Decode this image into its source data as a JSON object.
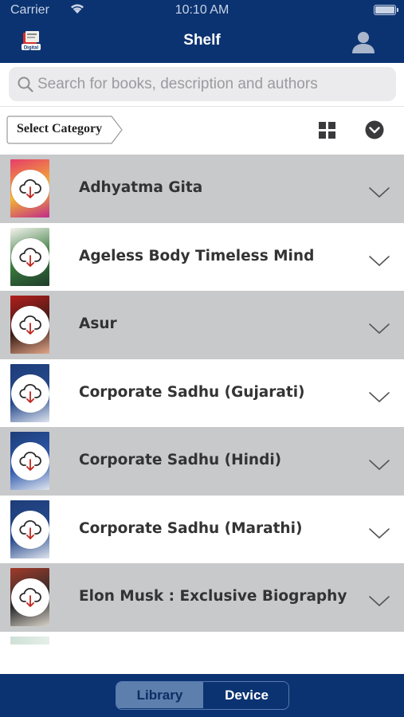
{
  "status_bar": {
    "carrier": "Carrier",
    "time": "10:10 AM"
  },
  "nav": {
    "title": "Shelf",
    "logo_icon": "digital-books-logo-icon",
    "profile_icon": "user-profile-icon"
  },
  "search": {
    "placeholder": "Search for books, description and authors",
    "value": ""
  },
  "filter": {
    "category_label": "Select Category",
    "grid_icon": "grid-view-icon",
    "sort_icon": "chevron-down-circle-icon"
  },
  "books": [
    {
      "title": "Adhyatma Gita",
      "cover_colors": [
        "#e63d6a",
        "#f5b531",
        "#c12c8a"
      ]
    },
    {
      "title": "Ageless Body Timeless Mind",
      "cover_colors": [
        "#f4f4ef",
        "#3a7a3d",
        "#1e3d2b"
      ]
    },
    {
      "title": "Asur",
      "cover_colors": [
        "#b21e1c",
        "#3b1c15",
        "#e1a68a"
      ]
    },
    {
      "title": "Corporate Sadhu (Gujarati)",
      "cover_colors": [
        "#1d3d78",
        "#274a8e",
        "#e0e5ee"
      ]
    },
    {
      "title": "Corporate Sadhu (Hindi)",
      "cover_colors": [
        "#1d3d78",
        "#2f5bb0",
        "#e0e5ee"
      ]
    },
    {
      "title": "Corporate Sadhu (Marathi)",
      "cover_colors": [
        "#1d3d78",
        "#274a8e",
        "#e0e5ee"
      ]
    },
    {
      "title": "Elon Musk : Exclusive Biography",
      "cover_colors": [
        "#a23a2a",
        "#2b2b2b",
        "#d8d2c8"
      ]
    }
  ],
  "tabs": {
    "library": "Library",
    "device": "Device",
    "active": "Library"
  },
  "colors": {
    "navy": "#0b3371",
    "row_alt": "#c8c9cb",
    "segment_active": "#5d7fae"
  }
}
